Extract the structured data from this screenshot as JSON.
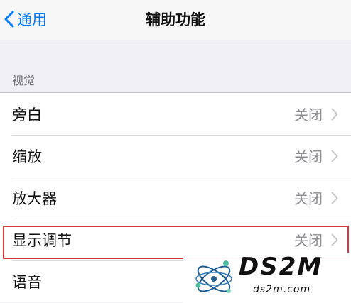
{
  "navbar": {
    "back_label": "通用",
    "title": "辅助功能"
  },
  "section": {
    "header": "视觉"
  },
  "rows": [
    {
      "label": "旁白",
      "value": "关闭"
    },
    {
      "label": "缩放",
      "value": "关闭"
    },
    {
      "label": "放大器",
      "value": "关闭"
    },
    {
      "label": "显示调节",
      "value": "关闭"
    },
    {
      "label": "语音",
      "value": ""
    }
  ],
  "watermark": {
    "brand": "DS2M",
    "url": "ds2m.com"
  },
  "icons": {
    "back": "chevron-left-icon",
    "disclosure": "chevron-right-icon",
    "logo": "atom-logo-icon"
  },
  "colors": {
    "accent": "#007aff",
    "highlight": "#d9343f",
    "background": "#efeff4"
  }
}
